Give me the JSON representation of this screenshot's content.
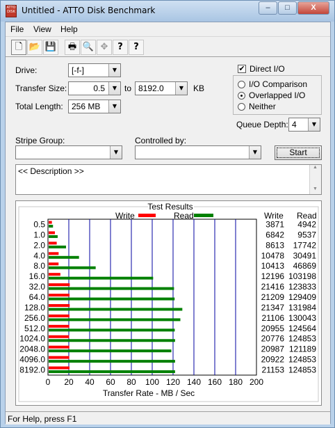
{
  "window": {
    "title": "Untitled - ATTO Disk Benchmark",
    "app_icon_text": "ATTO DISK",
    "controls": {
      "minimize": "–",
      "maximize": "□",
      "close": "X"
    }
  },
  "menu": {
    "file": "File",
    "view": "View",
    "help": "Help"
  },
  "toolbar": {
    "icons": [
      "new-icon",
      "open-icon",
      "save-icon",
      "print-icon",
      "print-preview-icon",
      "move-icon",
      "help-icon",
      "context-help-icon"
    ],
    "glyphs": [
      "🗋",
      "📂",
      "💾",
      "🖶",
      "🔍",
      "✥",
      "?",
      "?"
    ]
  },
  "settings": {
    "drive_label": "Drive:",
    "drive_value": "[-f-]",
    "transfer_size_label": "Transfer Size:",
    "transfer_size_from": "0.5",
    "to_label": "to",
    "transfer_size_to": "8192.0",
    "kb_label": "KB",
    "total_length_label": "Total Length:",
    "total_length_value": "256 MB",
    "direct_io_label": "Direct I/O",
    "direct_io_checked": true,
    "io_comparison_label": "I/O Comparison",
    "overlapped_io_label": "Overlapped I/O",
    "neither_label": "Neither",
    "selected_mode": "overlapped",
    "queue_depth_label": "Queue Depth:",
    "queue_depth_value": "4",
    "stripe_group_label": "Stripe Group:",
    "controlled_by_label": "Controlled by:",
    "start_label": "Start",
    "description_text": "<< Description >>"
  },
  "results": {
    "title": "Test Results",
    "legend_write": "Write",
    "legend_read": "Read",
    "col_write": "Write",
    "col_read": "Read",
    "write_color": "#ff0000",
    "read_color": "#008000"
  },
  "chart_data": {
    "type": "bar",
    "orientation": "horizontal",
    "title": "Test Results",
    "xlabel": "Transfer Rate - MB / Sec",
    "xlim": [
      0,
      200
    ],
    "x_ticks": [
      "0",
      "20",
      "40",
      "60",
      "80",
      "100",
      "120",
      "140",
      "160",
      "180",
      "200"
    ],
    "categories": [
      "0.5",
      "1.0",
      "2.0",
      "4.0",
      "8.0",
      "16.0",
      "32.0",
      "64.0",
      "128.0",
      "256.0",
      "512.0",
      "1024.0",
      "2048.0",
      "4096.0",
      "8192.0"
    ],
    "series": [
      {
        "name": "Write",
        "color": "#ff0000",
        "values": [
          3.78,
          6.68,
          8.41,
          10.23,
          10.17,
          11.91,
          20.91,
          20.71,
          20.85,
          20.61,
          20.46,
          20.29,
          20.5,
          20.43,
          20.66
        ]
      },
      {
        "name": "Read",
        "color": "#008000",
        "values": [
          4.83,
          9.31,
          17.33,
          29.78,
          45.77,
          100.88,
          120.93,
          121.49,
          128.89,
          127.0,
          121.64,
          121.93,
          118.35,
          121.93,
          121.93
        ]
      }
    ],
    "write_kbps": [
      "3871",
      "6842",
      "8613",
      "10478",
      "10413",
      "12196",
      "21416",
      "21209",
      "21347",
      "21106",
      "20955",
      "20776",
      "20987",
      "20922",
      "21153"
    ],
    "read_kbps": [
      "4942",
      "9537",
      "17742",
      "30491",
      "46869",
      "103198",
      "123833",
      "129409",
      "131984",
      "130043",
      "124564",
      "124853",
      "121189",
      "124853",
      "124853"
    ]
  },
  "status": {
    "text": "For Help, press F1"
  }
}
